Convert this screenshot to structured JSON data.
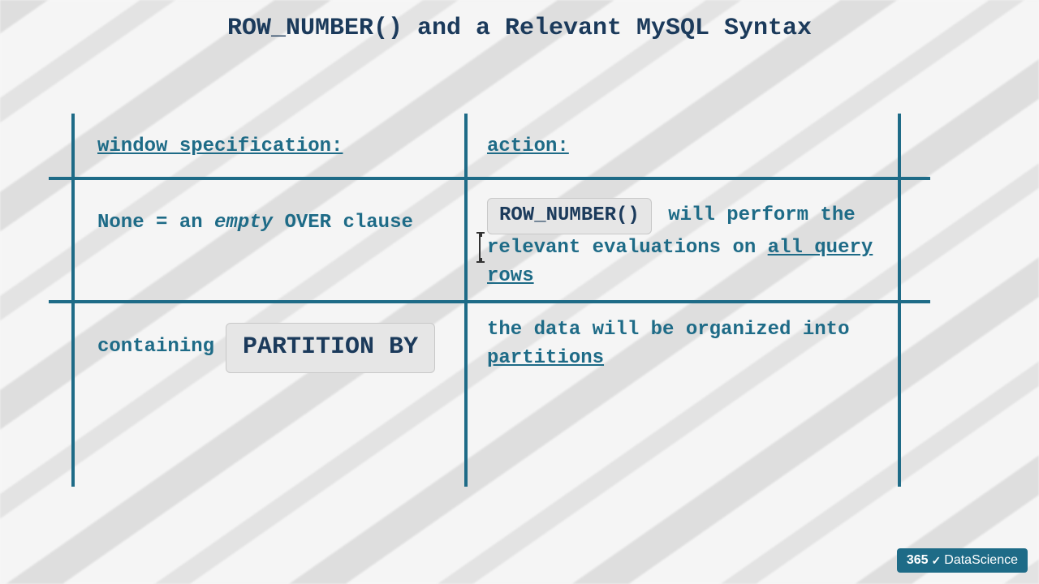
{
  "title": "ROW_NUMBER() and a Relevant MySQL Syntax",
  "headers": {
    "col1": "window specification:",
    "col2": "action:"
  },
  "row1": {
    "spec_prefix": "None = an ",
    "spec_emph": "empty",
    "spec_suffix": " OVER clause",
    "action_pill": "ROW_NUMBER()",
    "action_mid": " will perform the relevant evaluations on ",
    "action_und": "all query rows"
  },
  "row2": {
    "spec_prefix": "containing",
    "spec_pill": "PARTITION BY",
    "action_prefix": "the data will be organized into ",
    "action_und": "partitions"
  },
  "logo": {
    "brand_left": "365",
    "check": "✓",
    "brand_right": "DataScience"
  }
}
